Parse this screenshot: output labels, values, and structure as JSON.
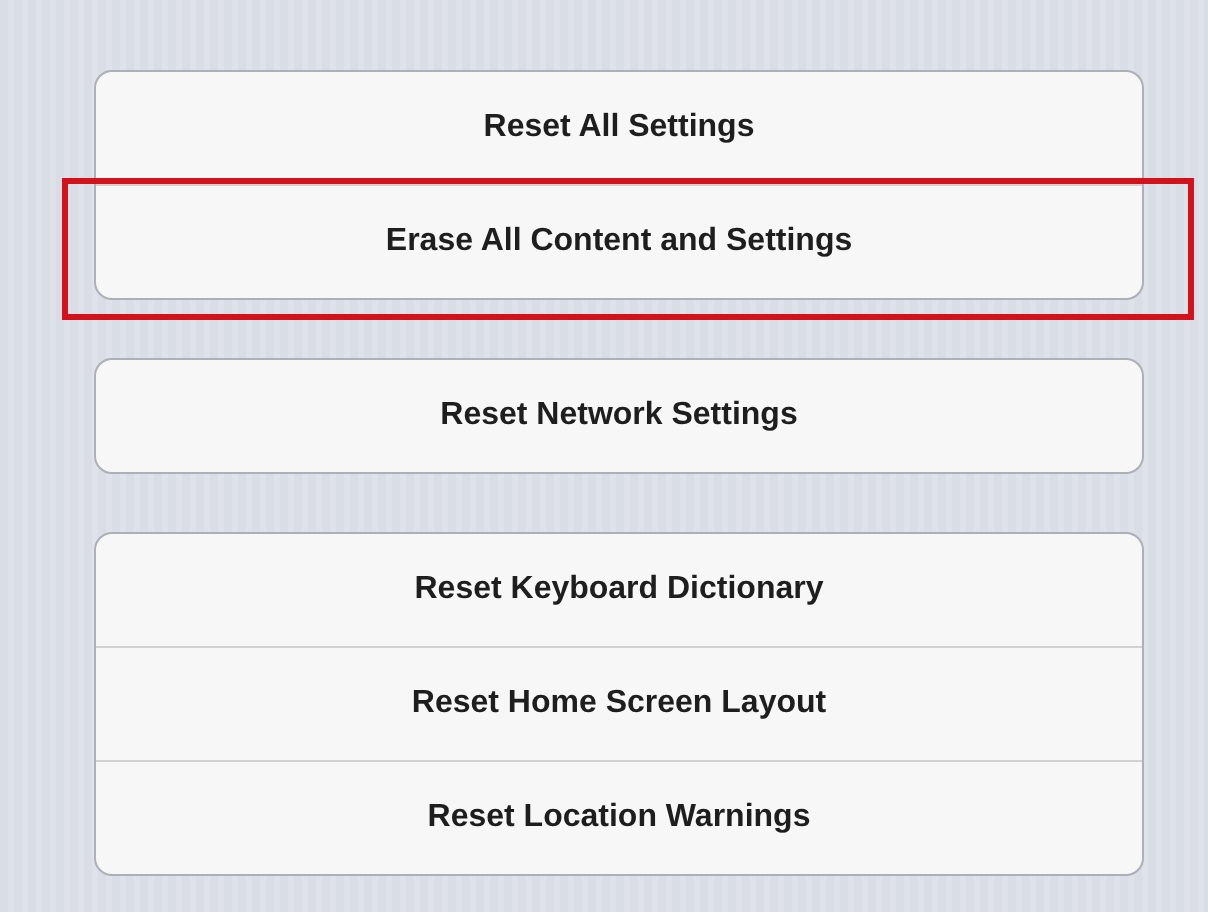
{
  "groups": [
    {
      "rows": [
        {
          "label": "Reset All Settings",
          "highlighted": false
        },
        {
          "label": "Erase All Content and Settings",
          "highlighted": true
        }
      ]
    },
    {
      "rows": [
        {
          "label": "Reset Network Settings",
          "highlighted": false
        }
      ]
    },
    {
      "rows": [
        {
          "label": "Reset Keyboard Dictionary",
          "highlighted": false
        },
        {
          "label": "Reset Home Screen Layout",
          "highlighted": false
        },
        {
          "label": "Reset Location Warnings",
          "highlighted": false
        }
      ]
    }
  ]
}
